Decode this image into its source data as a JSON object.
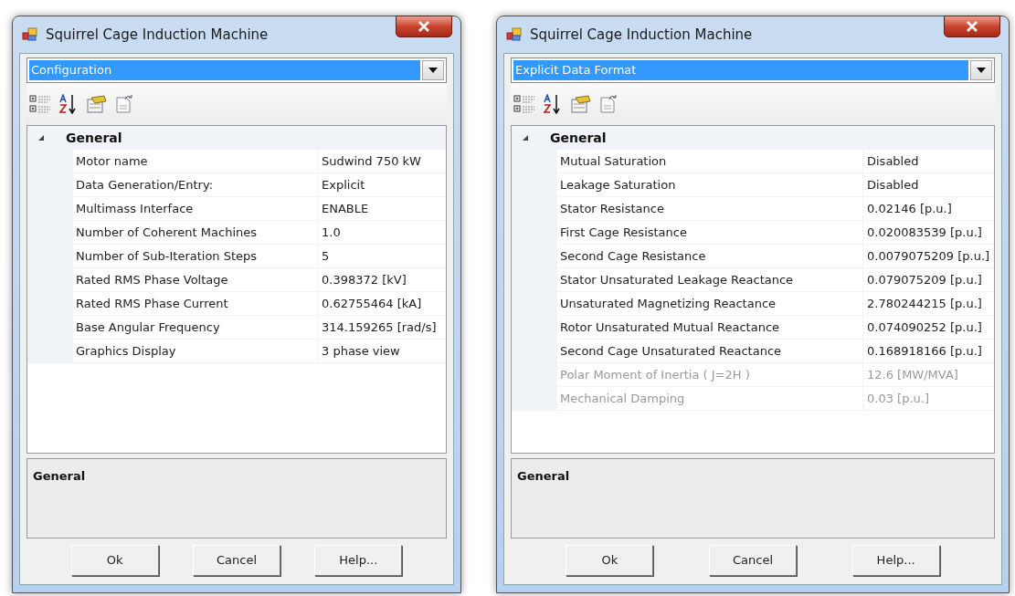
{
  "dialogs": [
    {
      "title": "Squirrel Cage Induction Machine",
      "dropdown": {
        "value": "Configuration"
      },
      "category": {
        "label": "General",
        "expanded": true
      },
      "properties": [
        {
          "name": "Motor name",
          "value": "Sudwind 750 kW",
          "disabled": false
        },
        {
          "name": "Data Generation/Entry:",
          "value": "Explicit",
          "disabled": false
        },
        {
          "name": "Multimass Interface",
          "value": "ENABLE",
          "disabled": false
        },
        {
          "name": "Number of Coherent Machines",
          "value": "1.0",
          "disabled": false
        },
        {
          "name": "Number of Sub-Iteration Steps",
          "value": "5",
          "disabled": false
        },
        {
          "name": "Rated RMS Phase Voltage",
          "value": "0.398372 [kV]",
          "disabled": false
        },
        {
          "name": "Rated RMS Phase Current",
          "value": "0.62755464 [kA]",
          "disabled": false
        },
        {
          "name": "Base Angular Frequency",
          "value": "314.159265 [rad/s]",
          "disabled": false
        },
        {
          "name": "Graphics Display",
          "value": "3 phase view",
          "disabled": false
        }
      ],
      "description": "General",
      "buttons": [
        "Ok",
        "Cancel",
        "Help..."
      ]
    },
    {
      "title": "Squirrel Cage Induction Machine",
      "dropdown": {
        "value": "Explicit Data Format"
      },
      "category": {
        "label": "General",
        "expanded": true
      },
      "properties": [
        {
          "name": "Mutual Saturation",
          "value": "Disabled",
          "disabled": false
        },
        {
          "name": "Leakage Saturation",
          "value": "Disabled",
          "disabled": false
        },
        {
          "name": "Stator Resistance",
          "value": "0.02146 [p.u.]",
          "disabled": false
        },
        {
          "name": "First Cage Resistance",
          "value": "0.020083539 [p.u.]",
          "disabled": false
        },
        {
          "name": "Second Cage Resistance",
          "value": "0.0079075209 [p.u.]",
          "disabled": false
        },
        {
          "name": "Stator Unsaturated Leakage Reactance",
          "value": "0.079075209 [p.u.]",
          "disabled": false
        },
        {
          "name": "Unsaturated Magnetizing Reactance",
          "value": "2.780244215 [p.u.]",
          "disabled": false
        },
        {
          "name": "Rotor Unsaturated Mutual Reactance",
          "value": "0.074090252 [p.u.]",
          "disabled": false
        },
        {
          "name": "Second Cage Unsaturated Reactance",
          "value": "0.168918166 [p.u.]",
          "disabled": false
        },
        {
          "name": "Polar Moment of Inertia ( J=2H )",
          "value": "12.6 [MW/MVA]",
          "disabled": true
        },
        {
          "name": "Mechanical Damping",
          "value": "0.03 [p.u.]",
          "disabled": true
        }
      ],
      "description": "General",
      "buttons": [
        "Ok",
        "Cancel",
        "Help..."
      ]
    }
  ]
}
